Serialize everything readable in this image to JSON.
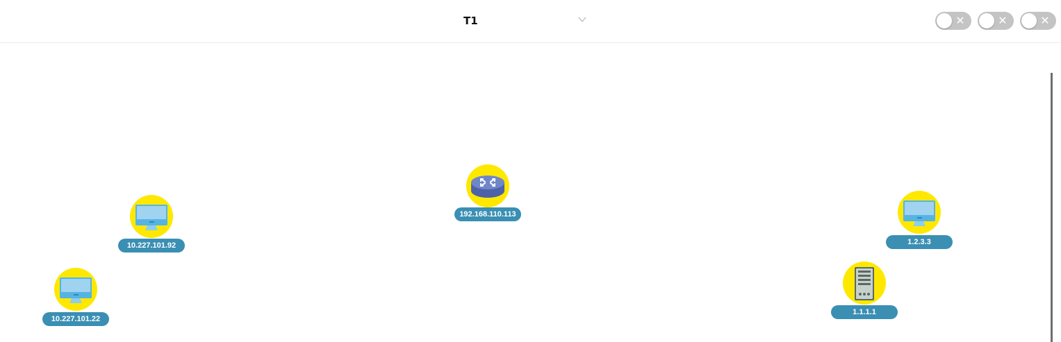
{
  "toolbar": {
    "topology_select": {
      "value": "T1"
    },
    "toggles": [
      {
        "state": "off",
        "off_glyph": "✕"
      },
      {
        "state": "off",
        "off_glyph": "✕"
      },
      {
        "state": "off",
        "off_glyph": "✕"
      }
    ]
  },
  "colors": {
    "node_disc": "#ffe800",
    "label_bg": "#3a8fb3",
    "label_text": "#ffffff",
    "toggle_off": "#c4c4c4"
  },
  "nodes": [
    {
      "id": "router",
      "ip": "192.168.110.113",
      "icon": "router-icon"
    },
    {
      "id": "pc1",
      "ip": "10.227.101.92",
      "icon": "desktop-computer-icon"
    },
    {
      "id": "pc2",
      "ip": "10.227.101.22",
      "icon": "desktop-computer-icon"
    },
    {
      "id": "pc3",
      "ip": "1.2.3.3",
      "icon": "desktop-computer-icon"
    },
    {
      "id": "server",
      "ip": "1.1.1.1",
      "icon": "server-icon"
    }
  ]
}
